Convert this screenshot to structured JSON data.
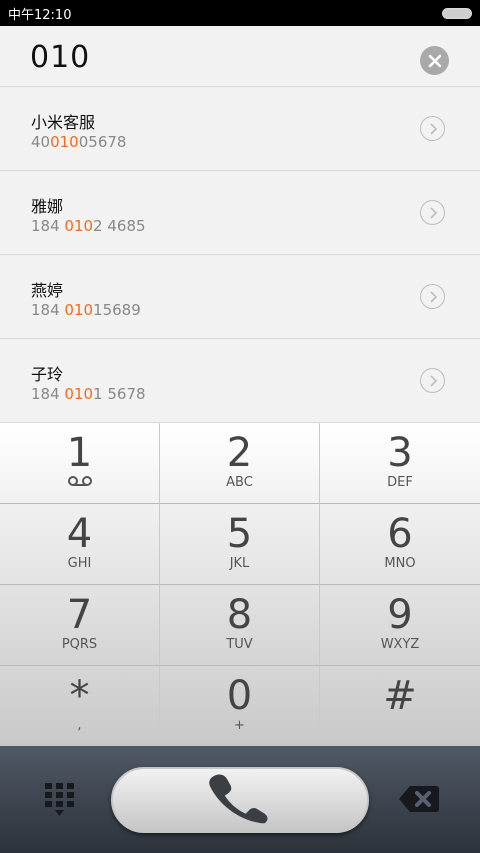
{
  "status_bar": {
    "time": "中午12:10"
  },
  "dial_input": {
    "digits": "010"
  },
  "contacts": [
    {
      "name": "小米客服",
      "number_pre": "40",
      "number_match": "010",
      "number_post": "05678"
    },
    {
      "name": "雅娜",
      "number_pre": "184 ",
      "number_match": "010",
      "number_post": "2 4685"
    },
    {
      "name": "燕婷",
      "number_pre": "184 ",
      "number_match": "010",
      "number_post": "15689"
    },
    {
      "name": "子玲",
      "number_pre": "184 ",
      "number_match": "010",
      "number_post": "1 5678"
    }
  ],
  "keypad": {
    "k1": {
      "num": "1",
      "sub": ""
    },
    "k2": {
      "num": "2",
      "sub": "ABC"
    },
    "k3": {
      "num": "3",
      "sub": "DEF"
    },
    "k4": {
      "num": "4",
      "sub": "GHI"
    },
    "k5": {
      "num": "5",
      "sub": "JKL"
    },
    "k6": {
      "num": "6",
      "sub": "MNO"
    },
    "k7": {
      "num": "7",
      "sub": "PQRS"
    },
    "k8": {
      "num": "8",
      "sub": "TUV"
    },
    "k9": {
      "num": "9",
      "sub": "WXYZ"
    },
    "kstar": {
      "num": "*",
      "sub": ","
    },
    "k0": {
      "num": "0",
      "sub": "+"
    },
    "khash": {
      "num": "#",
      "sub": ""
    }
  },
  "colors": {
    "match_highlight": "#f26b1d"
  }
}
